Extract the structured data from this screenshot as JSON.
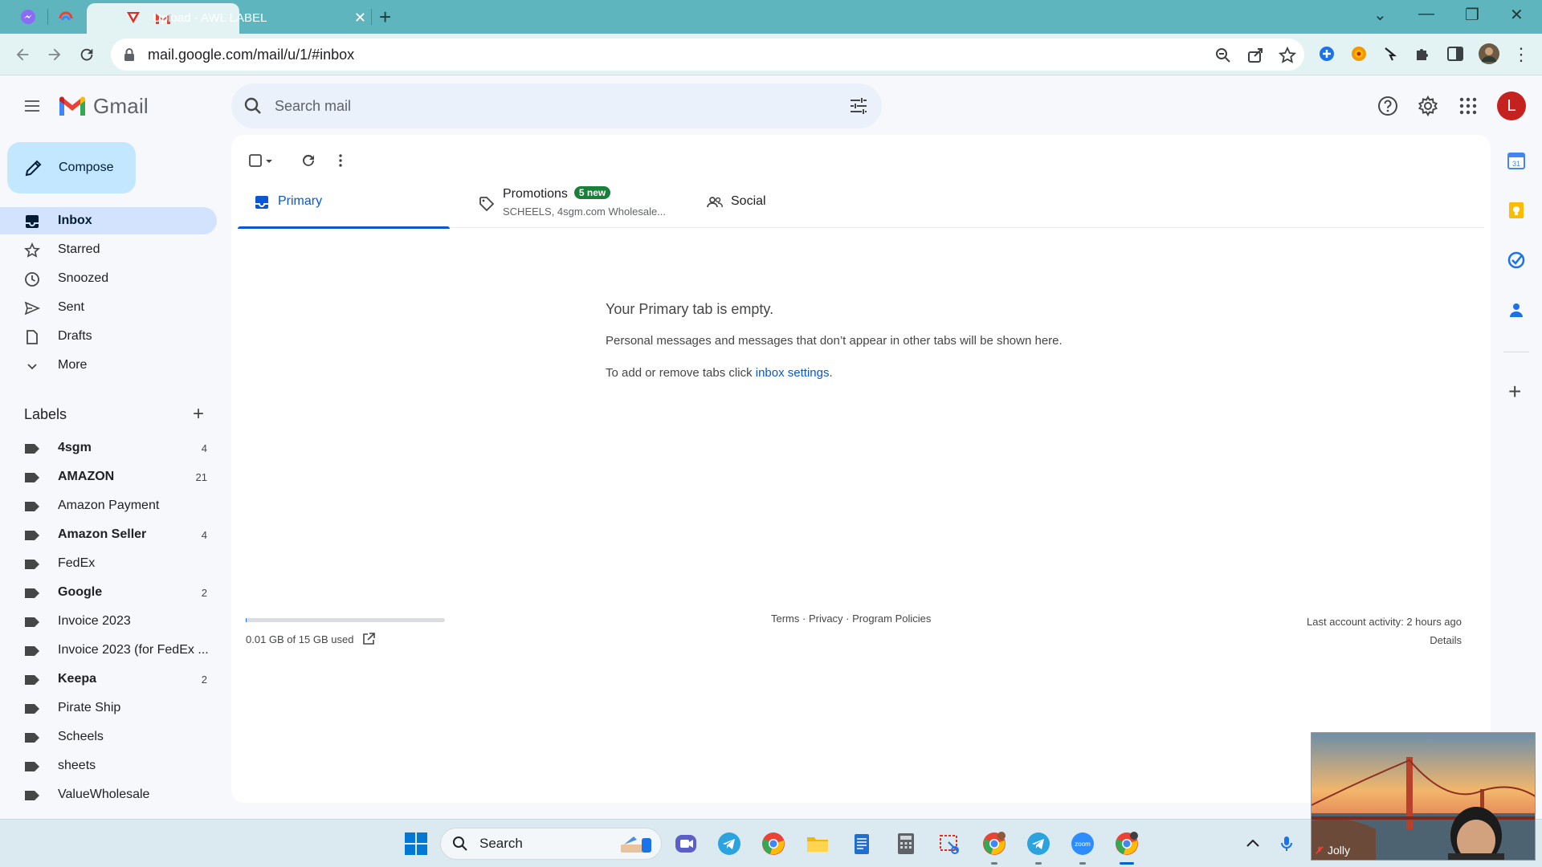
{
  "browser": {
    "tab_title": "Upload - AWL LABEL",
    "url": "mail.google.com/mail/u/1/#inbox"
  },
  "gmail": {
    "app_name": "Gmail",
    "search_placeholder": "Search mail",
    "avatar_letter": "L",
    "compose_label": "Compose",
    "nav": [
      {
        "label": "Inbox",
        "icon": "inbox-icon"
      },
      {
        "label": "Starred",
        "icon": "star-icon"
      },
      {
        "label": "Snoozed",
        "icon": "clock-icon"
      },
      {
        "label": "Sent",
        "icon": "send-icon"
      },
      {
        "label": "Drafts",
        "icon": "draft-icon"
      },
      {
        "label": "More",
        "icon": "chevron-down-icon"
      }
    ],
    "labels_title": "Labels",
    "labels": [
      {
        "name": "4sgm",
        "count": "4",
        "bold": true
      },
      {
        "name": "AMAZON",
        "count": "21",
        "bold": true
      },
      {
        "name": "Amazon Payment",
        "count": "",
        "bold": false
      },
      {
        "name": "Amazon Seller",
        "count": "4",
        "bold": true
      },
      {
        "name": "FedEx",
        "count": "",
        "bold": false
      },
      {
        "name": "Google",
        "count": "2",
        "bold": true
      },
      {
        "name": "Invoice 2023",
        "count": "",
        "bold": false
      },
      {
        "name": "Invoice 2023 (for FedEx ...",
        "count": "",
        "bold": false
      },
      {
        "name": "Keepa",
        "count": "2",
        "bold": true
      },
      {
        "name": "Pirate Ship",
        "count": "",
        "bold": false
      },
      {
        "name": "Scheels",
        "count": "",
        "bold": false
      },
      {
        "name": "sheets",
        "count": "",
        "bold": false
      },
      {
        "name": "ValueWholesale",
        "count": "",
        "bold": false
      }
    ],
    "tabs": {
      "primary": "Primary",
      "promotions": "Promotions",
      "promotions_badge": "5 new",
      "promotions_sub": "SCHEELS, 4sgm.com Wholesale...",
      "social": "Social"
    },
    "empty": {
      "title": "Your Primary tab is empty.",
      "line1": "Personal messages and messages that don’t appear in other tabs will be shown here.",
      "line2_prefix": "To add or remove tabs click ",
      "line2_link": "inbox settings",
      "line2_suffix": "."
    },
    "footer": {
      "storage": "0.01 GB of 15 GB used",
      "storage_fraction": 0.0007,
      "links": "Terms · Privacy · Program Policies",
      "activity": "Last account activity: 2 hours ago",
      "details": "Details"
    }
  },
  "taskbar": {
    "search_label": "Search"
  },
  "video": {
    "participant": "Jolly"
  },
  "colors": {
    "accent": "#0b57d0",
    "compose_bg": "#c2e7ff",
    "active_nav": "#d3e3fd",
    "badge_green": "#188038",
    "tabstrip": "#5fb5bd"
  }
}
